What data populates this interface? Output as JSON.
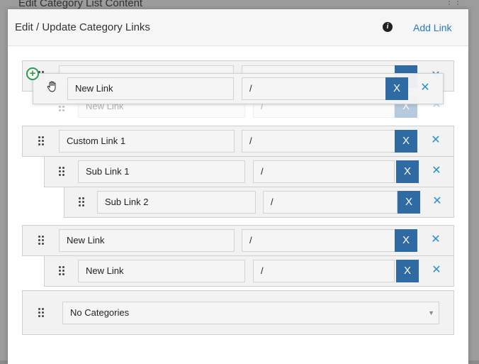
{
  "background": {
    "title": "Edit Category List Content"
  },
  "modal": {
    "title": "Edit / Update Category Links",
    "add_link_label": "Add Link",
    "info_icon": "info-icon"
  },
  "dragging_item": {
    "name": "New Link",
    "url": "/",
    "clear_label": "X",
    "remove_label": "✕"
  },
  "ghost_item": {
    "name": "New Link",
    "url": "/",
    "clear_label": "X",
    "remove_label": "✕"
  },
  "links": [
    {
      "name": "Custom Link 1",
      "url": "/",
      "clear_label": "X",
      "remove_label": "✕",
      "children": [
        {
          "name": "Sub Link 1",
          "url": "/",
          "clear_label": "X",
          "remove_label": "✕",
          "children": [
            {
              "name": "Sub Link 2",
              "url": "/",
              "clear_label": "X",
              "remove_label": "✕"
            }
          ]
        }
      ]
    },
    {
      "name": "New Link",
      "url": "/",
      "clear_label": "X",
      "remove_label": "✕",
      "children": [
        {
          "name": "New Link",
          "url": "/",
          "clear_label": "X",
          "remove_label": "✕"
        }
      ]
    }
  ],
  "category_select": {
    "value": "No Categories"
  },
  "colors": {
    "accent": "#2f6aa3",
    "link": "#2a7ab8",
    "add_icon": "#2f9a4a"
  }
}
